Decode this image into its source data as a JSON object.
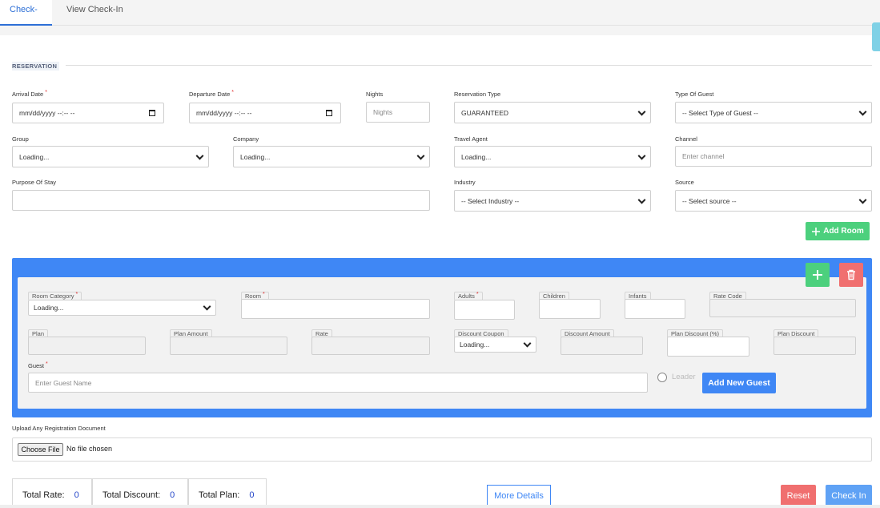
{
  "tabs": [
    {
      "label": "Check-In"
    },
    {
      "label": "View Check-In"
    }
  ],
  "reservation": {
    "section_title": "RESERVATION",
    "arrival_date": {
      "label": "Arrival Date",
      "value": "mm/dd/yyyy --:-- --"
    },
    "departure_date": {
      "label": "Departure Date",
      "value": "mm/dd/yyyy --:-- --"
    },
    "nights": {
      "label": "Nights",
      "placeholder": "Nights"
    },
    "reservation_type": {
      "label": "Reservation Type",
      "value": "GUARANTEED"
    },
    "type_of_guest": {
      "label": "Type Of Guest",
      "value": "-- Select Type of Guest --"
    },
    "group": {
      "label": "Group",
      "value": "Loading..."
    },
    "company": {
      "label": "Company",
      "value": "Loading..."
    },
    "travel_agent": {
      "label": "Travel Agent",
      "value": "Loading..."
    },
    "channel": {
      "label": "Channel",
      "placeholder": "Enter channel"
    },
    "purpose_of_stay": {
      "label": "Purpose Of Stay",
      "value": ""
    },
    "industry": {
      "label": "Industry",
      "value": "-- Select Industry --"
    },
    "source": {
      "label": "Source",
      "value": "-- Select source --"
    },
    "add_room_label": "Add Room"
  },
  "room": {
    "room_category": {
      "label": "Room Category",
      "value": "Loading..."
    },
    "room": {
      "label": "Room",
      "value": ""
    },
    "adults": {
      "label": "Adults",
      "value": ""
    },
    "children": {
      "label": "Children",
      "value": ""
    },
    "infants": {
      "label": "Infants",
      "value": ""
    },
    "rate_code": {
      "label": "Rate Code",
      "value": ""
    },
    "plan": {
      "label": "Plan",
      "value": ""
    },
    "plan_amount": {
      "label": "Plan Amount",
      "value": ""
    },
    "rate": {
      "label": "Rate",
      "value": ""
    },
    "discount_coupon": {
      "label": "Discount Coupon",
      "value": "Loading..."
    },
    "discount_amount": {
      "label": "Discount Amount",
      "value": ""
    },
    "plan_discount_pct": {
      "label": "Plan Discount (%)",
      "value": ""
    },
    "plan_discount": {
      "label": "Plan Discount",
      "value": ""
    },
    "guest": {
      "label": "Guest",
      "placeholder": "Enter Guest Name"
    },
    "leader_label": "Leader",
    "add_new_guest_label": "Add New Guest"
  },
  "upload": {
    "label": "Upload Any Registration Document",
    "choose_label": "Choose File",
    "status": "No file chosen"
  },
  "totals": {
    "total_rate": {
      "label": "Total Rate:",
      "value": "0"
    },
    "total_discount": {
      "label": "Total Discount:",
      "value": "0"
    },
    "total_plan": {
      "label": "Total Plan:",
      "value": "0"
    }
  },
  "actions": {
    "more_details": "More Details",
    "reset": "Reset",
    "check_in": "Check In"
  },
  "colors": {
    "accent": "#3f87f5",
    "success": "#4cd07d",
    "danger": "#f06f6f",
    "required": "#e03131"
  }
}
